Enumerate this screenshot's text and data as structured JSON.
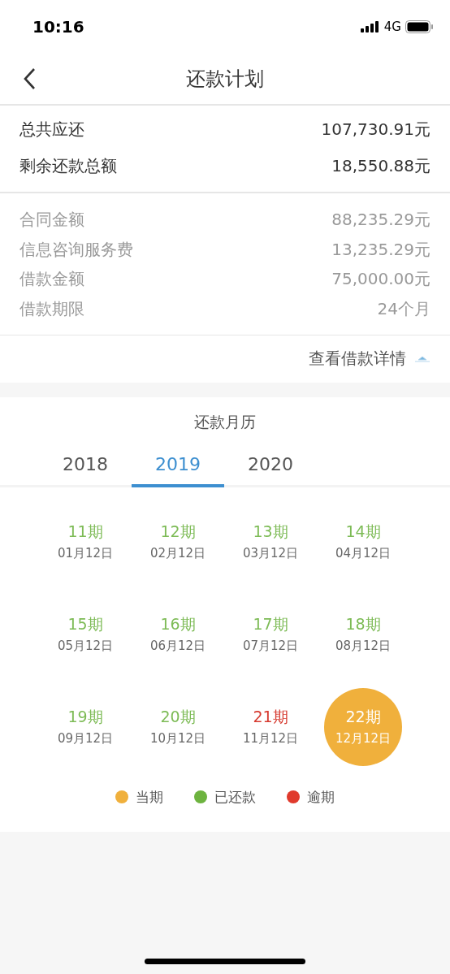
{
  "status_bar": {
    "time": "10:16",
    "network": "4G"
  },
  "nav": {
    "title": "还款计划"
  },
  "summary": [
    {
      "label": "总共应还",
      "value": "107,730.91元"
    },
    {
      "label": "剩余还款总额",
      "value": "18,550.88元"
    }
  ],
  "details": [
    {
      "label": "合同金额",
      "value": "88,235.29元"
    },
    {
      "label": "信息咨询服务费",
      "value": "13,235.29元"
    },
    {
      "label": "借款金额",
      "value": "75,000.00元"
    },
    {
      "label": "借款期限",
      "value": "24个月"
    }
  ],
  "details_toggle": {
    "label": "查看借款详情",
    "expanded": true
  },
  "calendar": {
    "title": "还款月历",
    "tabs": [
      {
        "label": "2018",
        "selected": false
      },
      {
        "label": "2019",
        "selected": true
      },
      {
        "label": "2020",
        "selected": false
      }
    ],
    "installments": [
      {
        "period": "11期",
        "date": "01月12日",
        "kind": "paid"
      },
      {
        "period": "12期",
        "date": "02月12日",
        "kind": "paid"
      },
      {
        "period": "13期",
        "date": "03月12日",
        "kind": "paid"
      },
      {
        "period": "14期",
        "date": "04月12日",
        "kind": "paid"
      },
      {
        "period": "15期",
        "date": "05月12日",
        "kind": "paid"
      },
      {
        "period": "16期",
        "date": "06月12日",
        "kind": "paid"
      },
      {
        "period": "17期",
        "date": "07月12日",
        "kind": "paid"
      },
      {
        "period": "18期",
        "date": "08月12日",
        "kind": "paid"
      },
      {
        "period": "19期",
        "date": "09月12日",
        "kind": "paid"
      },
      {
        "period": "20期",
        "date": "10月12日",
        "kind": "paid"
      },
      {
        "period": "21期",
        "date": "11月12日",
        "kind": "overdue"
      },
      {
        "period": "22期",
        "date": "12月12日",
        "kind": "current"
      }
    ],
    "legend": [
      {
        "label": "当期",
        "color": "#f0b03c"
      },
      {
        "label": "已还款",
        "color": "#6db33f"
      },
      {
        "label": "逾期",
        "color": "#e03a2c"
      }
    ]
  }
}
